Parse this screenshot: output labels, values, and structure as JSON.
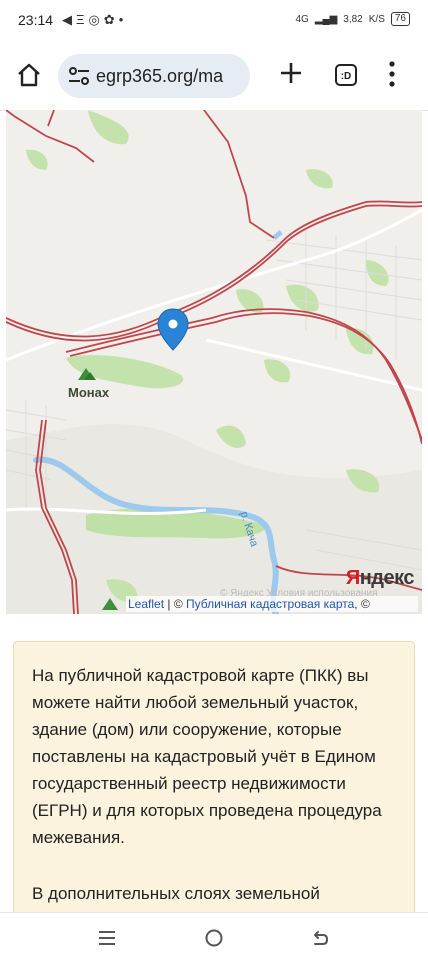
{
  "status_bar": {
    "time": "23:14",
    "network": "4G",
    "speed": "3,82",
    "speed_unit": "K/S",
    "battery": "76"
  },
  "browser": {
    "url": "egrp365.org/ma",
    "tab_count": ":D"
  },
  "map": {
    "place_label": "Монах",
    "river_label": "р. Кача",
    "provider_logo": "Яндекс",
    "provider_note": "© Яндекс  Условия использования",
    "attribution": {
      "leaflet": "Leaflet",
      "separator": " | © ",
      "cadastral": "Публичная кадастровая карта",
      "suffix": ", ©"
    }
  },
  "info": {
    "paragraph1": "На публичной кадастровой карте (ПКК) вы можете найти любой земельный участок, здание (дом) или сооружение, которые поставлены на кадастровый учёт в Едином государственный реестр недвижимости (ЕГРН) и для которых проведена процедура межевания.",
    "paragraph2": "В дополнительных слоях земельной"
  },
  "colors": {
    "boundary": "#c0464c",
    "forest": "#bfe0a6",
    "water": "#9cc9ec",
    "marker": "#2a84d6",
    "info_bg": "#fcf3df"
  }
}
